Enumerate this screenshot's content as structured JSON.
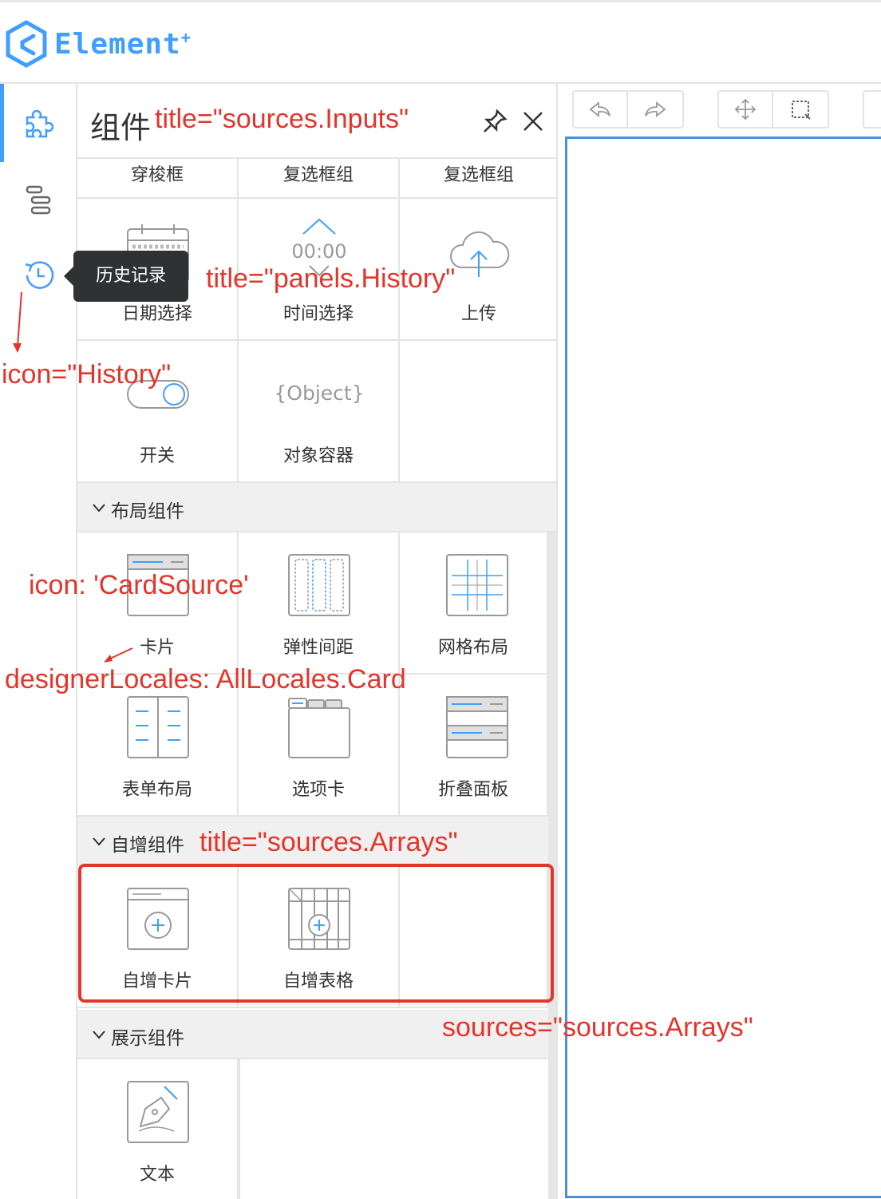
{
  "app": {
    "logo_text": "Element",
    "logo_sup": "+"
  },
  "rail": {
    "items": [
      {
        "icon": "puzzle-icon",
        "active": true
      },
      {
        "icon": "outline-tree-icon",
        "active": false
      },
      {
        "icon": "history-icon",
        "active": false
      }
    ],
    "tooltip": "历史记录"
  },
  "panel": {
    "title": "组件",
    "pin_icon": "pin-icon",
    "close_icon": "close-icon",
    "top_row": [
      "穿梭框",
      "复选框组",
      "复选框组"
    ],
    "inputs": [
      {
        "label": "日期选择",
        "icon": "calendar-icon"
      },
      {
        "label": "时间选择",
        "icon": "time-picker-icon",
        "icon_text": "00:00"
      },
      {
        "label": "上传",
        "icon": "upload-cloud-icon"
      },
      {
        "label": "开关",
        "icon": "switch-icon"
      },
      {
        "label": "对象容器",
        "icon": "object-icon",
        "icon_text": "{Object}"
      }
    ],
    "sections": [
      {
        "title": "布局组件",
        "items": [
          {
            "label": "卡片",
            "icon": "card-icon"
          },
          {
            "label": "弹性间距",
            "icon": "space-icon"
          },
          {
            "label": "网格布局",
            "icon": "grid-icon"
          },
          {
            "label": "表单布局",
            "icon": "form-layout-icon"
          },
          {
            "label": "选项卡",
            "icon": "tabs-icon"
          },
          {
            "label": "折叠面板",
            "icon": "collapse-icon"
          }
        ]
      },
      {
        "title": "自增组件",
        "items": [
          {
            "label": "自增卡片",
            "icon": "array-card-icon"
          },
          {
            "label": "自增表格",
            "icon": "array-table-icon"
          }
        ]
      },
      {
        "title": "展示组件",
        "items": [
          {
            "label": "文本",
            "icon": "text-icon"
          }
        ]
      }
    ]
  },
  "toolbar": {
    "undo_icon": "undo-icon",
    "redo_icon": "redo-icon",
    "move_icon": "move-icon",
    "select_icon": "selection-icon"
  },
  "annotations": {
    "title_inputs": "title=\"sources.Inputs\"",
    "panels_history": "title=\"panels.History\"",
    "icon_history": "icon=\"History\"",
    "icon_card": "icon: 'CardSource'",
    "locales_card": "designerLocales: AllLocales.Card",
    "title_arrays": "title=\"sources.Arrays\"",
    "sources_arrays": "sources=\"sources.Arrays\""
  },
  "colors": {
    "accent": "#409eff",
    "annotation": "#e5342a",
    "tooltip_bg": "#303133"
  }
}
